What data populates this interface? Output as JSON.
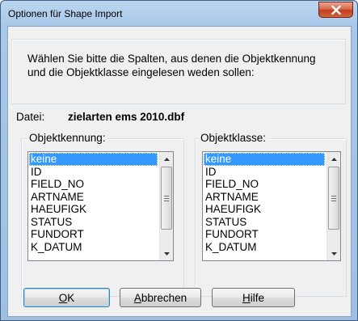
{
  "window": {
    "title": "Optionen für Shape Import",
    "close_icon": "close-icon"
  },
  "instructions": "Wählen Sie bitte die Spalten, aus denen die Objektkennung und die Objektklasse eingelesen weden sollen:",
  "file": {
    "label": "Datei:",
    "name": "zielarten ems 2010.dbf"
  },
  "objektkennung": {
    "label": "Objektkennung:",
    "selected": "keine",
    "items": [
      "keine",
      "ID",
      "FIELD_NO",
      "ARTNAME",
      "HAEUFIGK",
      "STATUS",
      "FUNDORT",
      "K_DATUM"
    ]
  },
  "objektklasse": {
    "label": "Objektklasse:",
    "selected": "keine",
    "items": [
      "keine",
      "ID",
      "FIELD_NO",
      "ARTNAME",
      "HAEUFIGK",
      "STATUS",
      "FUNDORT",
      "K_DATUM"
    ]
  },
  "buttons": {
    "ok": {
      "mnemonic": "O",
      "rest": "K"
    },
    "cancel": {
      "mnemonic": "A",
      "rest": "bbrechen"
    },
    "help": {
      "mnemonic": "H",
      "rest": "ilfe"
    }
  },
  "colors": {
    "selection": "#3399ff",
    "close_button": "#c23f1f",
    "title_bar": "#a9c8e8"
  }
}
